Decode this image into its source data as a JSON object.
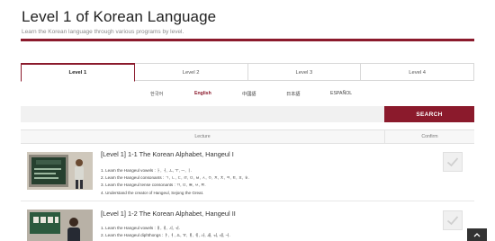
{
  "header": {
    "title": "Level 1 of Korean Language",
    "subtitle": "Learn the Korean language through various programs by level."
  },
  "tabs": [
    {
      "label": "Level 1",
      "active": true
    },
    {
      "label": "Level 2",
      "active": false
    },
    {
      "label": "Level 3",
      "active": false
    },
    {
      "label": "Level 4",
      "active": false
    }
  ],
  "languages": [
    {
      "label": "한국어",
      "active": false
    },
    {
      "label": "English",
      "active": true
    },
    {
      "label": "中國語",
      "active": false
    },
    {
      "label": "日本語",
      "active": false
    },
    {
      "label": "ESPAÑOL",
      "active": false
    }
  ],
  "search": {
    "placeholder": "",
    "button_label": "SEARCH"
  },
  "table": {
    "headers": {
      "lecture": "Lecture",
      "confirm": "Confirm"
    },
    "rows": [
      {
        "title": "[Level 1] 1-1 The Korean Alphabet, Hangeul I",
        "items": [
          "1. Learn the Hangeul vowels : ㅏ, ㅓ, ㅗ, ㅜ, ㅡ, ㅣ.",
          "2. Learn the Hangeul consonants : ㄱ, ㄴ, ㄷ, ㄹ, ㅁ, ㅂ, ㅅ, ㅇ, ㅈ, ㅊ, ㅋ, ㅌ, ㅍ, ㅎ.",
          "3. Learn the Hangeul tense consonants : ㄲ, ㄸ, ㅃ, ㅆ, ㅉ.",
          "4. Understand the creator of Hangeul, Sejong the Great."
        ]
      },
      {
        "title": "[Level 1] 1-2 The Korean Alphabet, Hangeul II",
        "items": [
          "1. Learn the Hangeul vowels : ㅐ, ㅔ, ㅚ, ㅟ.",
          "2. Learn the Hangeul diphthongs : ㅑ, ㅕ, ㅛ, ㅠ, ㅒ, ㅖ, ㅘ, ㅙ, ㅝ, ㅞ, ㅢ."
        ]
      }
    ]
  },
  "colors": {
    "accent": "#8b1a2c",
    "tab_border": "#d8d8d8",
    "search_bg": "#f1f1f1"
  },
  "icons": {
    "confirm": "check-icon",
    "scroll_top": "chevron-up-icon"
  }
}
